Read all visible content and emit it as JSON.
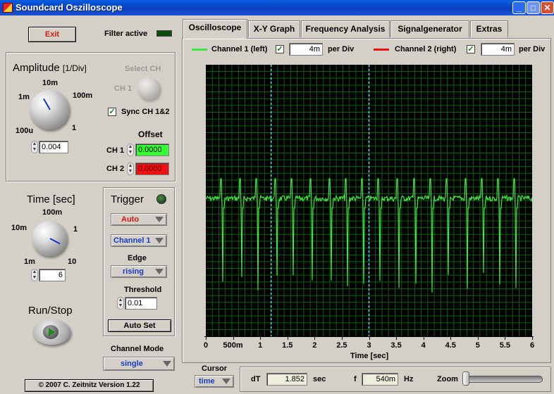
{
  "window": {
    "title": "Soundcard Oszilloscope"
  },
  "left": {
    "exit_label": "Exit",
    "filter_label": "Filter active",
    "amplitude": {
      "title": "Amplitude",
      "unit": "[1/Div]",
      "knob_labels": [
        "10m",
        "1m",
        "100m",
        "100u",
        "1"
      ],
      "value": "0.004",
      "select_ch_label": "Select CH",
      "ch1_toggle_label": "CH 1",
      "sync_label": "Sync CH 1&2",
      "sync_checked": "✓",
      "offset_title": "Offset",
      "ch1_label": "CH 1",
      "ch1_offset": "0.0000",
      "ch2_label": "CH 2",
      "ch2_offset": "0.0000"
    },
    "time": {
      "title": "Time [sec]",
      "knob_labels": [
        "100m",
        "10m",
        "1",
        "1m",
        "10"
      ],
      "value": "6"
    },
    "trigger": {
      "title": "Trigger",
      "mode": "Auto",
      "channel": "Channel 1",
      "edge_label": "Edge",
      "edge": "rising",
      "threshold_label": "Threshold",
      "threshold": "0.01",
      "autoset_label": "Auto Set"
    },
    "run_stop_label": "Run/Stop",
    "channel_mode_label": "Channel Mode",
    "channel_mode": "single",
    "copyright": "© 2007  C. Zeitnitz Version 1.22"
  },
  "tabs": [
    "Oscilloscope",
    "X-Y Graph",
    "Frequency Analysis",
    "Signalgenerator",
    "Extras"
  ],
  "legend": {
    "ch1_name": "Channel 1 (left)",
    "ch1_check": "✓",
    "ch1_div": "4m",
    "ch1_per": "per Div",
    "ch2_name": "Channel 2 (right)",
    "ch2_check": "✓",
    "ch2_div": "4m",
    "ch2_per": "per Div"
  },
  "colors": {
    "ch1": "#3fe63f",
    "ch2": "#e81010",
    "grid": "#0d5e0d",
    "cursor": "#66ddff"
  },
  "chart_data": {
    "type": "line",
    "xlabel": "Time [sec]",
    "x_ticks": [
      "0",
      "500m",
      "1",
      "1.5",
      "2",
      "2.5",
      "3",
      "3.5",
      "4",
      "4.5",
      "5",
      "5.5",
      "6"
    ],
    "xlim": [
      0,
      6
    ],
    "grid": true,
    "cursors_x": [
      1.2,
      3.0
    ],
    "series": [
      {
        "name": "Channel 1 (left)",
        "baseline": 0.0,
        "spike_times": [
          0.3,
          0.65,
          0.95,
          1.3,
          1.6,
          1.95,
          2.3,
          2.6,
          2.9,
          3.2,
          3.55,
          3.85,
          4.15,
          4.45,
          4.8,
          5.1,
          5.4,
          5.7
        ]
      }
    ]
  },
  "bottom": {
    "cursor_label": "Cursor",
    "cursor_mode": "time",
    "dt_label": "dT",
    "dt_value": "1.852",
    "dt_unit": "sec",
    "f_label": "f",
    "f_value": "540m",
    "f_unit": "Hz",
    "zoom_label": "Zoom"
  }
}
